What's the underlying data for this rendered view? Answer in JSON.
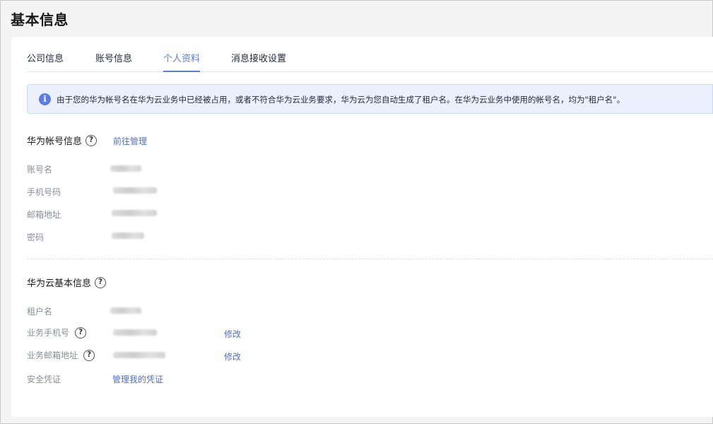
{
  "page": {
    "title": "基本信息"
  },
  "tabs": [
    {
      "label": "公司信息",
      "active": false
    },
    {
      "label": "账号信息",
      "active": false
    },
    {
      "label": "个人资料",
      "active": true
    },
    {
      "label": "消息接收设置",
      "active": false
    }
  ],
  "notice": {
    "icon": "info-icon",
    "text": "由于您的华为帐号名在华为云业务中已经被占用，或者不符合华为云业务要求，华为云为您自动生成了租户名。在华为云业务中使用的帐号名，均为\"租户名\"。"
  },
  "huawei_account": {
    "title": "华为帐号信息",
    "manage_link": "前往管理",
    "fields": [
      {
        "label": "账号名"
      },
      {
        "label": "手机号码"
      },
      {
        "label": "邮箱地址"
      },
      {
        "label": "密码"
      }
    ]
  },
  "cloud_basic": {
    "title": "华为云基本信息",
    "fields": [
      {
        "label": "租户名"
      },
      {
        "label": "业务手机号",
        "action": "修改"
      },
      {
        "label": "业务邮箱地址",
        "action": "修改"
      },
      {
        "label": "安全凭证",
        "link": "管理我的凭证"
      }
    ]
  },
  "colors": {
    "accent": "#5e7ce0",
    "link": "#526ecc",
    "notice_bg": "#eaf1fd",
    "label": "#8a8e99"
  }
}
